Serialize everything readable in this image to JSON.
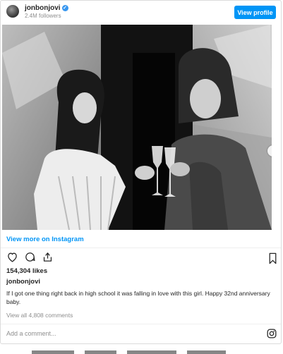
{
  "header": {
    "username": "jonbonjovi",
    "verified_icon": "verified-badge-icon",
    "followers": "2.4M followers",
    "view_profile_label": "View profile"
  },
  "post": {
    "image_alt_icon": "photo-image",
    "carousel_index": 1,
    "carousel_total": 2
  },
  "view_more_label": "View more on Instagram",
  "actions": {
    "like_icon": "heart-icon",
    "comment_icon": "comment-icon",
    "share_icon": "share-icon",
    "save_icon": "bookmark-icon"
  },
  "likes": "154,304 likes",
  "owner": "jonbonjovi",
  "caption": "If I got one thing right back in high school it was falling in love with this girl. Happy 32nd anniversary baby.",
  "comments_link": "View all 4,808 comments",
  "add_comment_placeholder": "Add a comment...",
  "colors": {
    "accent": "#0095f6",
    "text": "#262626",
    "muted": "#8e8e8e"
  }
}
